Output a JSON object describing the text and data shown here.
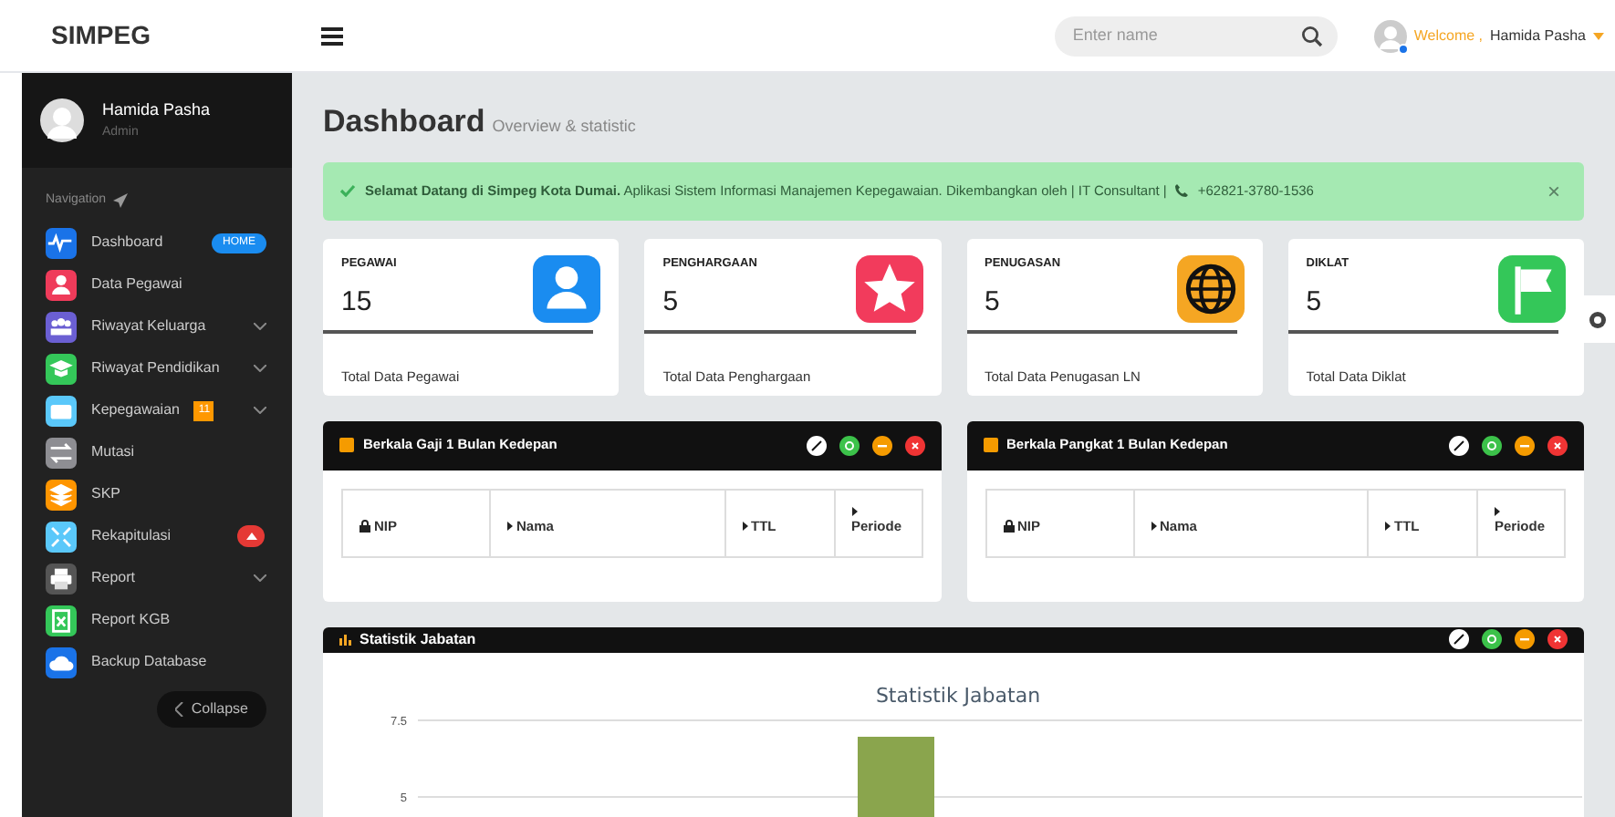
{
  "brand": "SIMPEG",
  "search": {
    "placeholder": "Enter name"
  },
  "user_menu": {
    "greeting": "Welcome ,",
    "name": "Hamida Pasha",
    "online": true
  },
  "profile": {
    "name": "Hamida Pasha",
    "role": "Admin"
  },
  "nav_heading": "Navigation",
  "sidebar_items": [
    {
      "label": "Dashboard",
      "color": "#1a73e8",
      "badge": {
        "kind": "pill",
        "text": "HOME"
      },
      "expandable": false
    },
    {
      "label": "Data Pegawai",
      "color": "#ef3b5a",
      "expandable": false
    },
    {
      "label": "Riwayat Keluarga",
      "color": "#6b5fd3",
      "expandable": true
    },
    {
      "label": "Riwayat Pendidikan",
      "color": "#34c759",
      "expandable": true
    },
    {
      "label": "Kepegawaian",
      "color": "#5ac8fa",
      "badge": {
        "kind": "square",
        "text": "11"
      },
      "expandable": true
    },
    {
      "label": "Mutasi",
      "color": "#8e8e93",
      "expandable": false
    },
    {
      "label": "SKP",
      "color": "#ff9500",
      "expandable": false
    },
    {
      "label": "Rekapitulasi",
      "color": "#5ac8fa",
      "badge": {
        "kind": "dot"
      },
      "expandable": false
    },
    {
      "label": "Report",
      "color": "#555555",
      "expandable": true
    },
    {
      "label": "Report KGB",
      "color": "#34c759",
      "expandable": false
    },
    {
      "label": "Backup Database",
      "color": "#1a73e8",
      "expandable": false
    }
  ],
  "collapse_button": "Collapse",
  "page_title": "Dashboard",
  "page_subtitle": "Overview & statistic",
  "alert": {
    "text": "**Selamat Datang di Simpeg Kota Dumai.** Aplikasi Sistem Informasi Manajemen Kepegawaian. Dikembangkan oleh | IT Consultant |",
    "phone": "+62821-3780-1536",
    "close": "×"
  },
  "stat_cards": [
    {
      "label": "PEGAWAI",
      "value": "15",
      "footer": "Total Data Pegawai",
      "color": "#1a8cf0"
    },
    {
      "label": "PENGHARGAAN",
      "value": "5",
      "footer": "Total Data Penghargaan",
      "color": "#f23b5c"
    },
    {
      "label": "PENUGASAN",
      "value": "5",
      "footer": "Total Data Penugasan LN",
      "color": "#f5a623"
    },
    {
      "label": "DIKLAT",
      "value": "5",
      "footer": "Total Data Diklat",
      "color": "#34c759"
    }
  ],
  "table_panels": [
    {
      "title": "Berkala Gaji 1 Bulan Kedepan",
      "columns": [
        "NIP",
        "Nama",
        "TTL",
        "Periode"
      ]
    },
    {
      "title": "Berkala Pangkat 1 Bulan Kedepan",
      "columns": [
        "NIP",
        "Nama",
        "TTL",
        "Periode"
      ]
    }
  ],
  "chart_panel": {
    "title": "Statistik Jabatan",
    "chart_title": "Statistik Jabatan",
    "y_axis_labels": [
      "7.5",
      "5"
    ]
  }
}
